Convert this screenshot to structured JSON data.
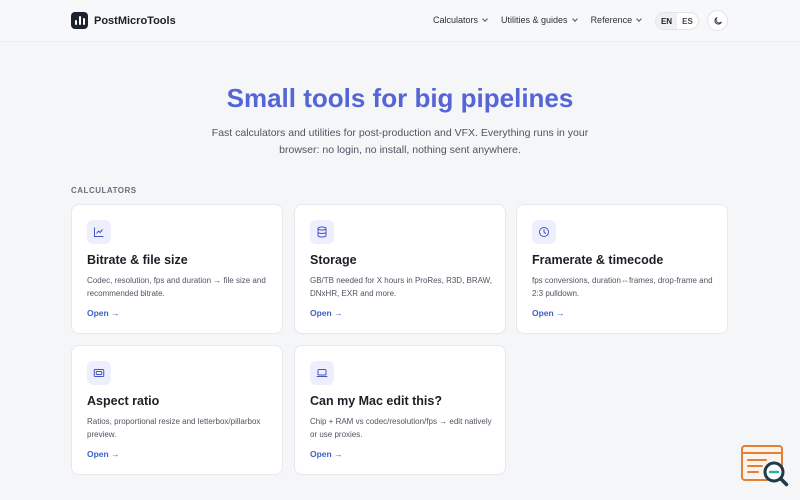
{
  "header": {
    "brand": "PostMicroTools",
    "nav": [
      {
        "label": "Calculators"
      },
      {
        "label": "Utilities & guides"
      },
      {
        "label": "Reference"
      }
    ],
    "languages": [
      "EN",
      "ES"
    ],
    "active_language": "EN",
    "theme_icon": "moon-icon"
  },
  "hero": {
    "title": "Small tools for big pipelines",
    "subtitle": "Fast calculators and utilities for post-production and VFX. Everything runs in your browser: no login, no install, nothing sent anywhere."
  },
  "calculators": {
    "label": "CALCULATORS",
    "cards": [
      {
        "icon": "line-chart-icon",
        "title": "Bitrate & file size",
        "desc": "Codec, resolution, fps and duration → file size and recommended bitrate.",
        "link": "Open →"
      },
      {
        "icon": "database-icon",
        "title": "Storage",
        "desc": "GB/TB needed for X hours in ProRes, R3D, BRAW, DNxHR, EXR and more.",
        "link": "Open →"
      },
      {
        "icon": "clock-icon",
        "title": "Framerate & timecode",
        "desc": "fps conversions, duration⇔frames, drop-frame and 2:3 pulldown.",
        "link": "Open →"
      },
      {
        "icon": "aspect-ratio-icon",
        "title": "Aspect ratio",
        "desc": "Ratios, proportional resize and letterbox/pillarbox preview.",
        "link": "Open →"
      },
      {
        "icon": "laptop-icon",
        "title": "Can my Mac edit this?",
        "desc": "Chip + RAM vs codec/resolution/fps → edit natively or use proxies.",
        "link": "Open →"
      }
    ]
  },
  "colors": {
    "accent": "#5565d6",
    "link": "#3e62c6",
    "background": "#f5f6f8"
  }
}
